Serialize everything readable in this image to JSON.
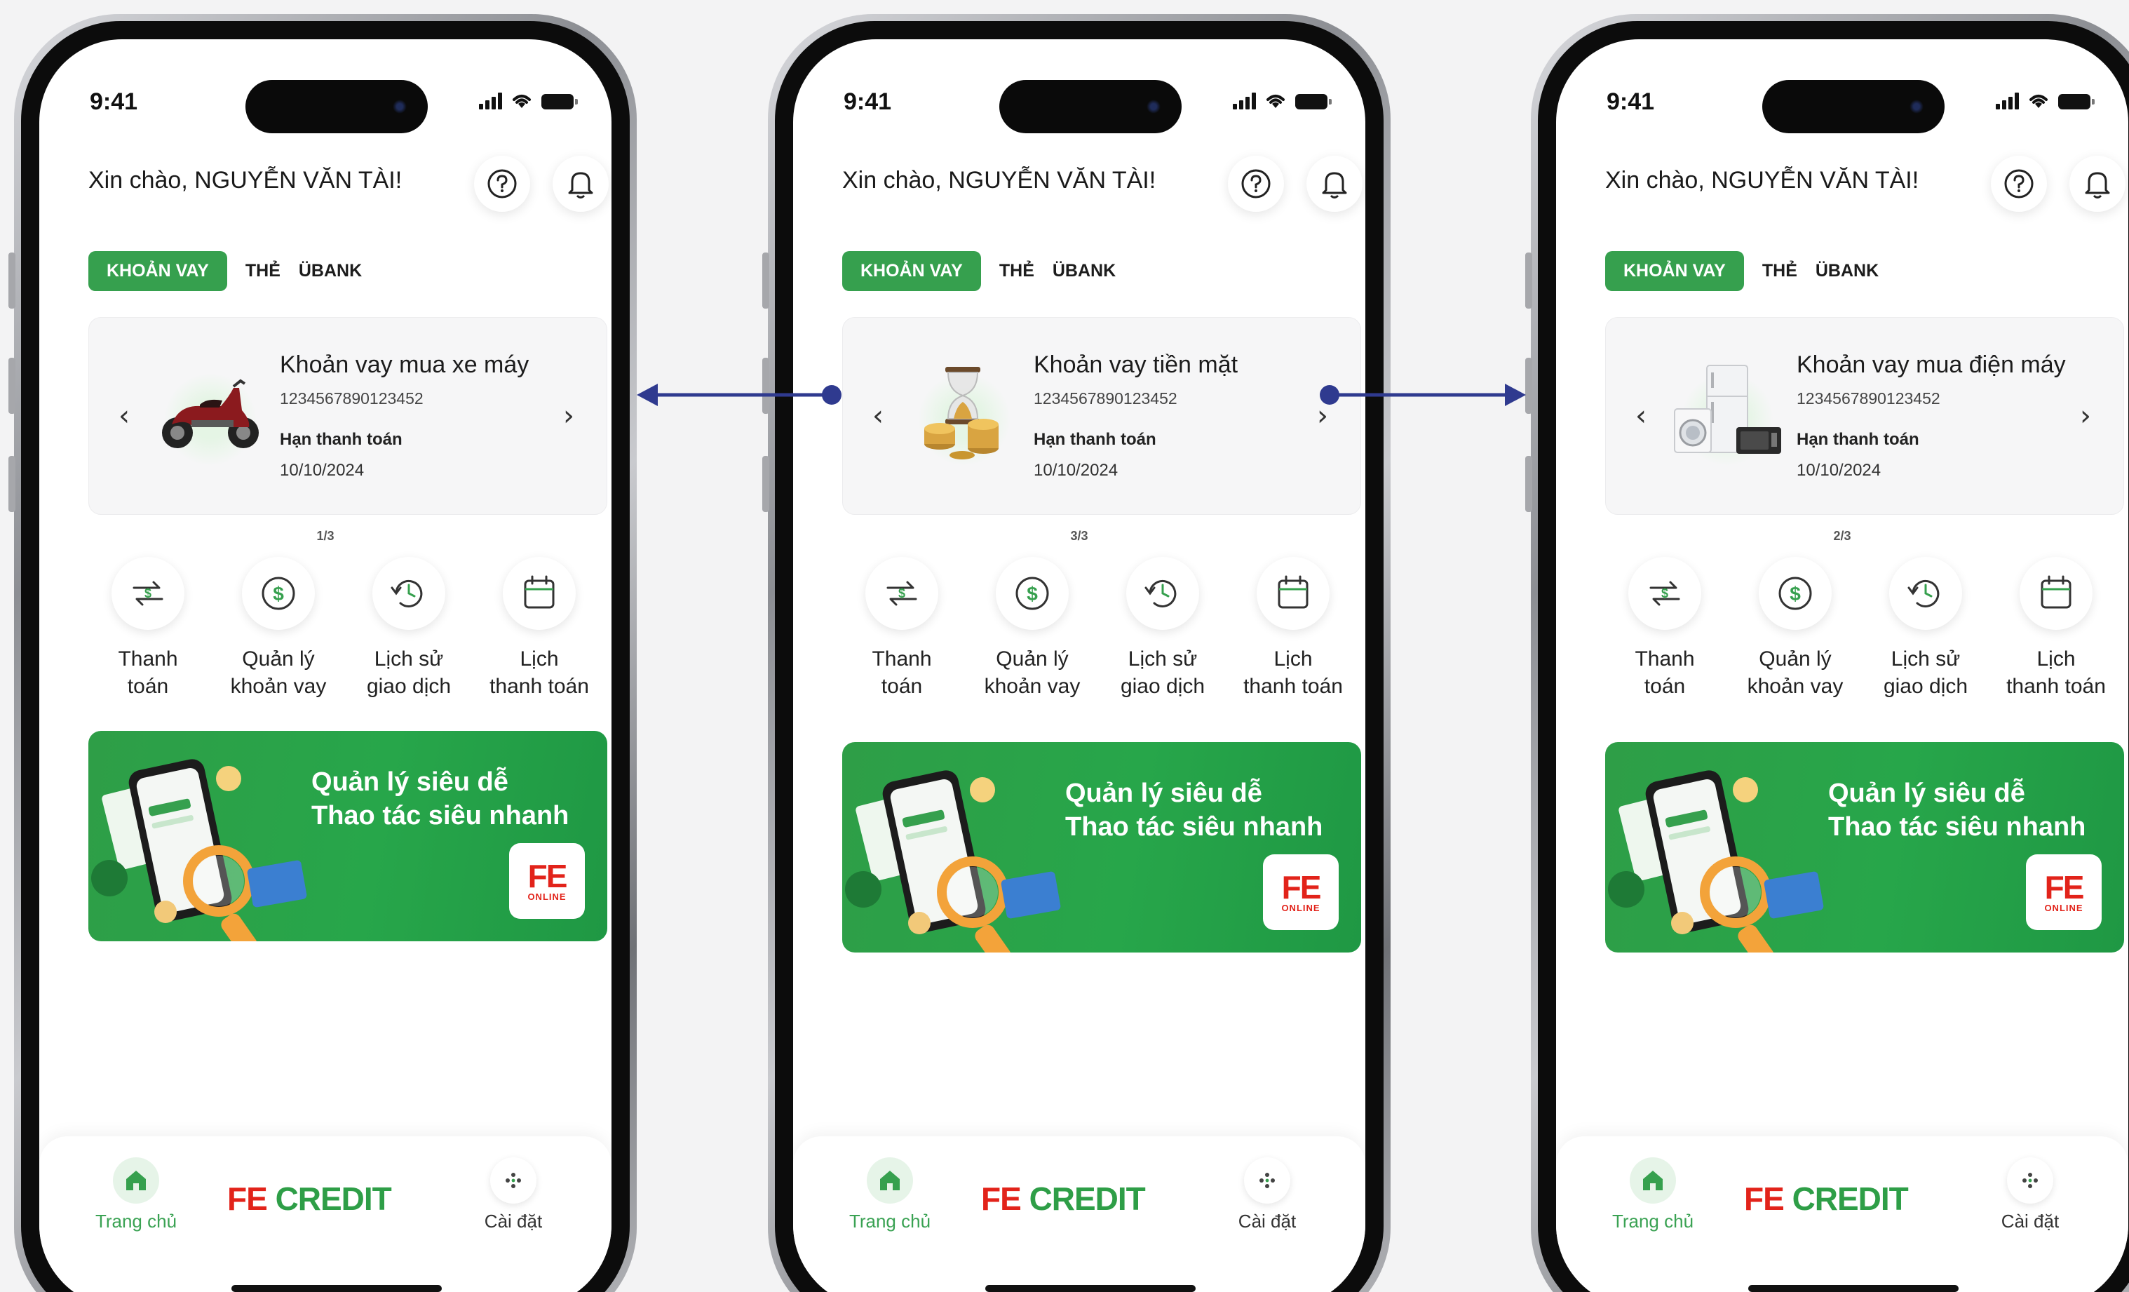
{
  "status_bar": {
    "time": "9:41"
  },
  "header": {
    "greeting": "Xin chào, NGUYỄN VĂN TÀI!"
  },
  "tabs": [
    "KHOẢN VAY",
    "THẺ",
    "ÜBANK"
  ],
  "actions": [
    {
      "icon": "transfer-icon",
      "label": "Thanh\ntoán"
    },
    {
      "icon": "dollar-icon",
      "label": "Quản lý\nkhoản vay"
    },
    {
      "icon": "history-icon",
      "label": "Lịch sử\ngiao dịch"
    },
    {
      "icon": "calendar-icon",
      "label": "Lịch\nthanh toán"
    }
  ],
  "banner": {
    "line1": "Quản lý siêu dễ",
    "line2": "Thao tác siêu nhanh",
    "badge_fe": "FE",
    "badge_online": "ONLINE"
  },
  "bottom_nav": {
    "home": "Trang chủ",
    "brand_fe": "FE",
    "brand_credit": "CREDIT",
    "settings": "Cài đặt"
  },
  "screens": [
    {
      "loan": {
        "title": "Khoản vay mua xe máy",
        "number": "1234567890123452",
        "due_label": "Hạn thanh toán",
        "due_date": "10/10/2024",
        "image": "motorbike-image"
      },
      "pager": "1/3"
    },
    {
      "loan": {
        "title": "Khoản vay tiền mặt",
        "number": "1234567890123452",
        "due_label": "Hạn thanh toán",
        "due_date": "10/10/2024",
        "image": "hourglass-coins-image"
      },
      "pager": "3/3"
    },
    {
      "loan": {
        "title": "Khoản vay mua điện máy",
        "number": "1234567890123452",
        "due_label": "Hạn thanh toán",
        "due_date": "10/10/2024",
        "image": "appliances-image"
      },
      "pager": "2/3"
    }
  ],
  "colors": {
    "brand_green": "#36a04e",
    "brand_red": "#e2231a",
    "connector": "#2f3a8f"
  }
}
